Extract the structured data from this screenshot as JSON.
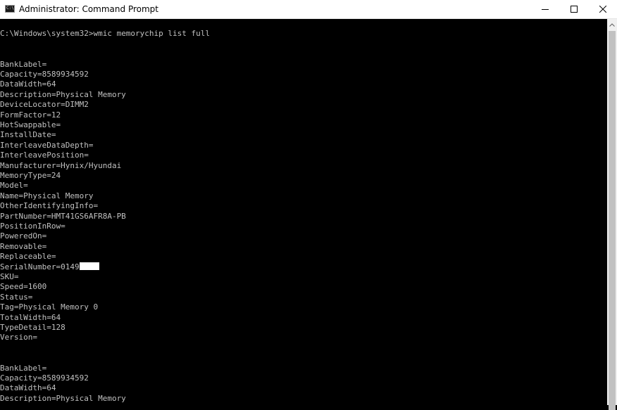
{
  "window": {
    "title": "Administrator: Command Prompt",
    "icon_text": "C:\\_",
    "controls": [
      "minimize-icon",
      "maximize-icon",
      "close-icon"
    ]
  },
  "console": {
    "prompt": "C:\\Windows\\system32>",
    "command": "wmic memorychip list full",
    "block1": [
      "BankLabel=",
      "Capacity=8589934592",
      "DataWidth=64",
      "Description=Physical Memory",
      "DeviceLocator=DIMM2",
      "FormFactor=12",
      "HotSwappable=",
      "InstallDate=",
      "InterleaveDataDepth=",
      "InterleavePosition=",
      "Manufacturer=Hynix/Hyundai",
      "MemoryType=24",
      "Model=",
      "Name=Physical Memory",
      "OtherIdentifyingInfo=",
      "PartNumber=HMT41GS6AFR8A-PB",
      "PositionInRow=",
      "PoweredOn=",
      "Removable=",
      "Replaceable=",
      "SerialNumber=0149",
      "SKU=",
      "Speed=1600",
      "Status=",
      "Tag=Physical Memory 0",
      "TotalWidth=64",
      "TypeDetail=128",
      "Version="
    ],
    "block2": [
      "BankLabel=",
      "Capacity=8589934592",
      "DataWidth=64",
      "Description=Physical Memory"
    ]
  },
  "colors": {
    "console_bg": "#000000",
    "console_fg": "#c0c0c0",
    "titlebar_bg": "#ffffff"
  }
}
